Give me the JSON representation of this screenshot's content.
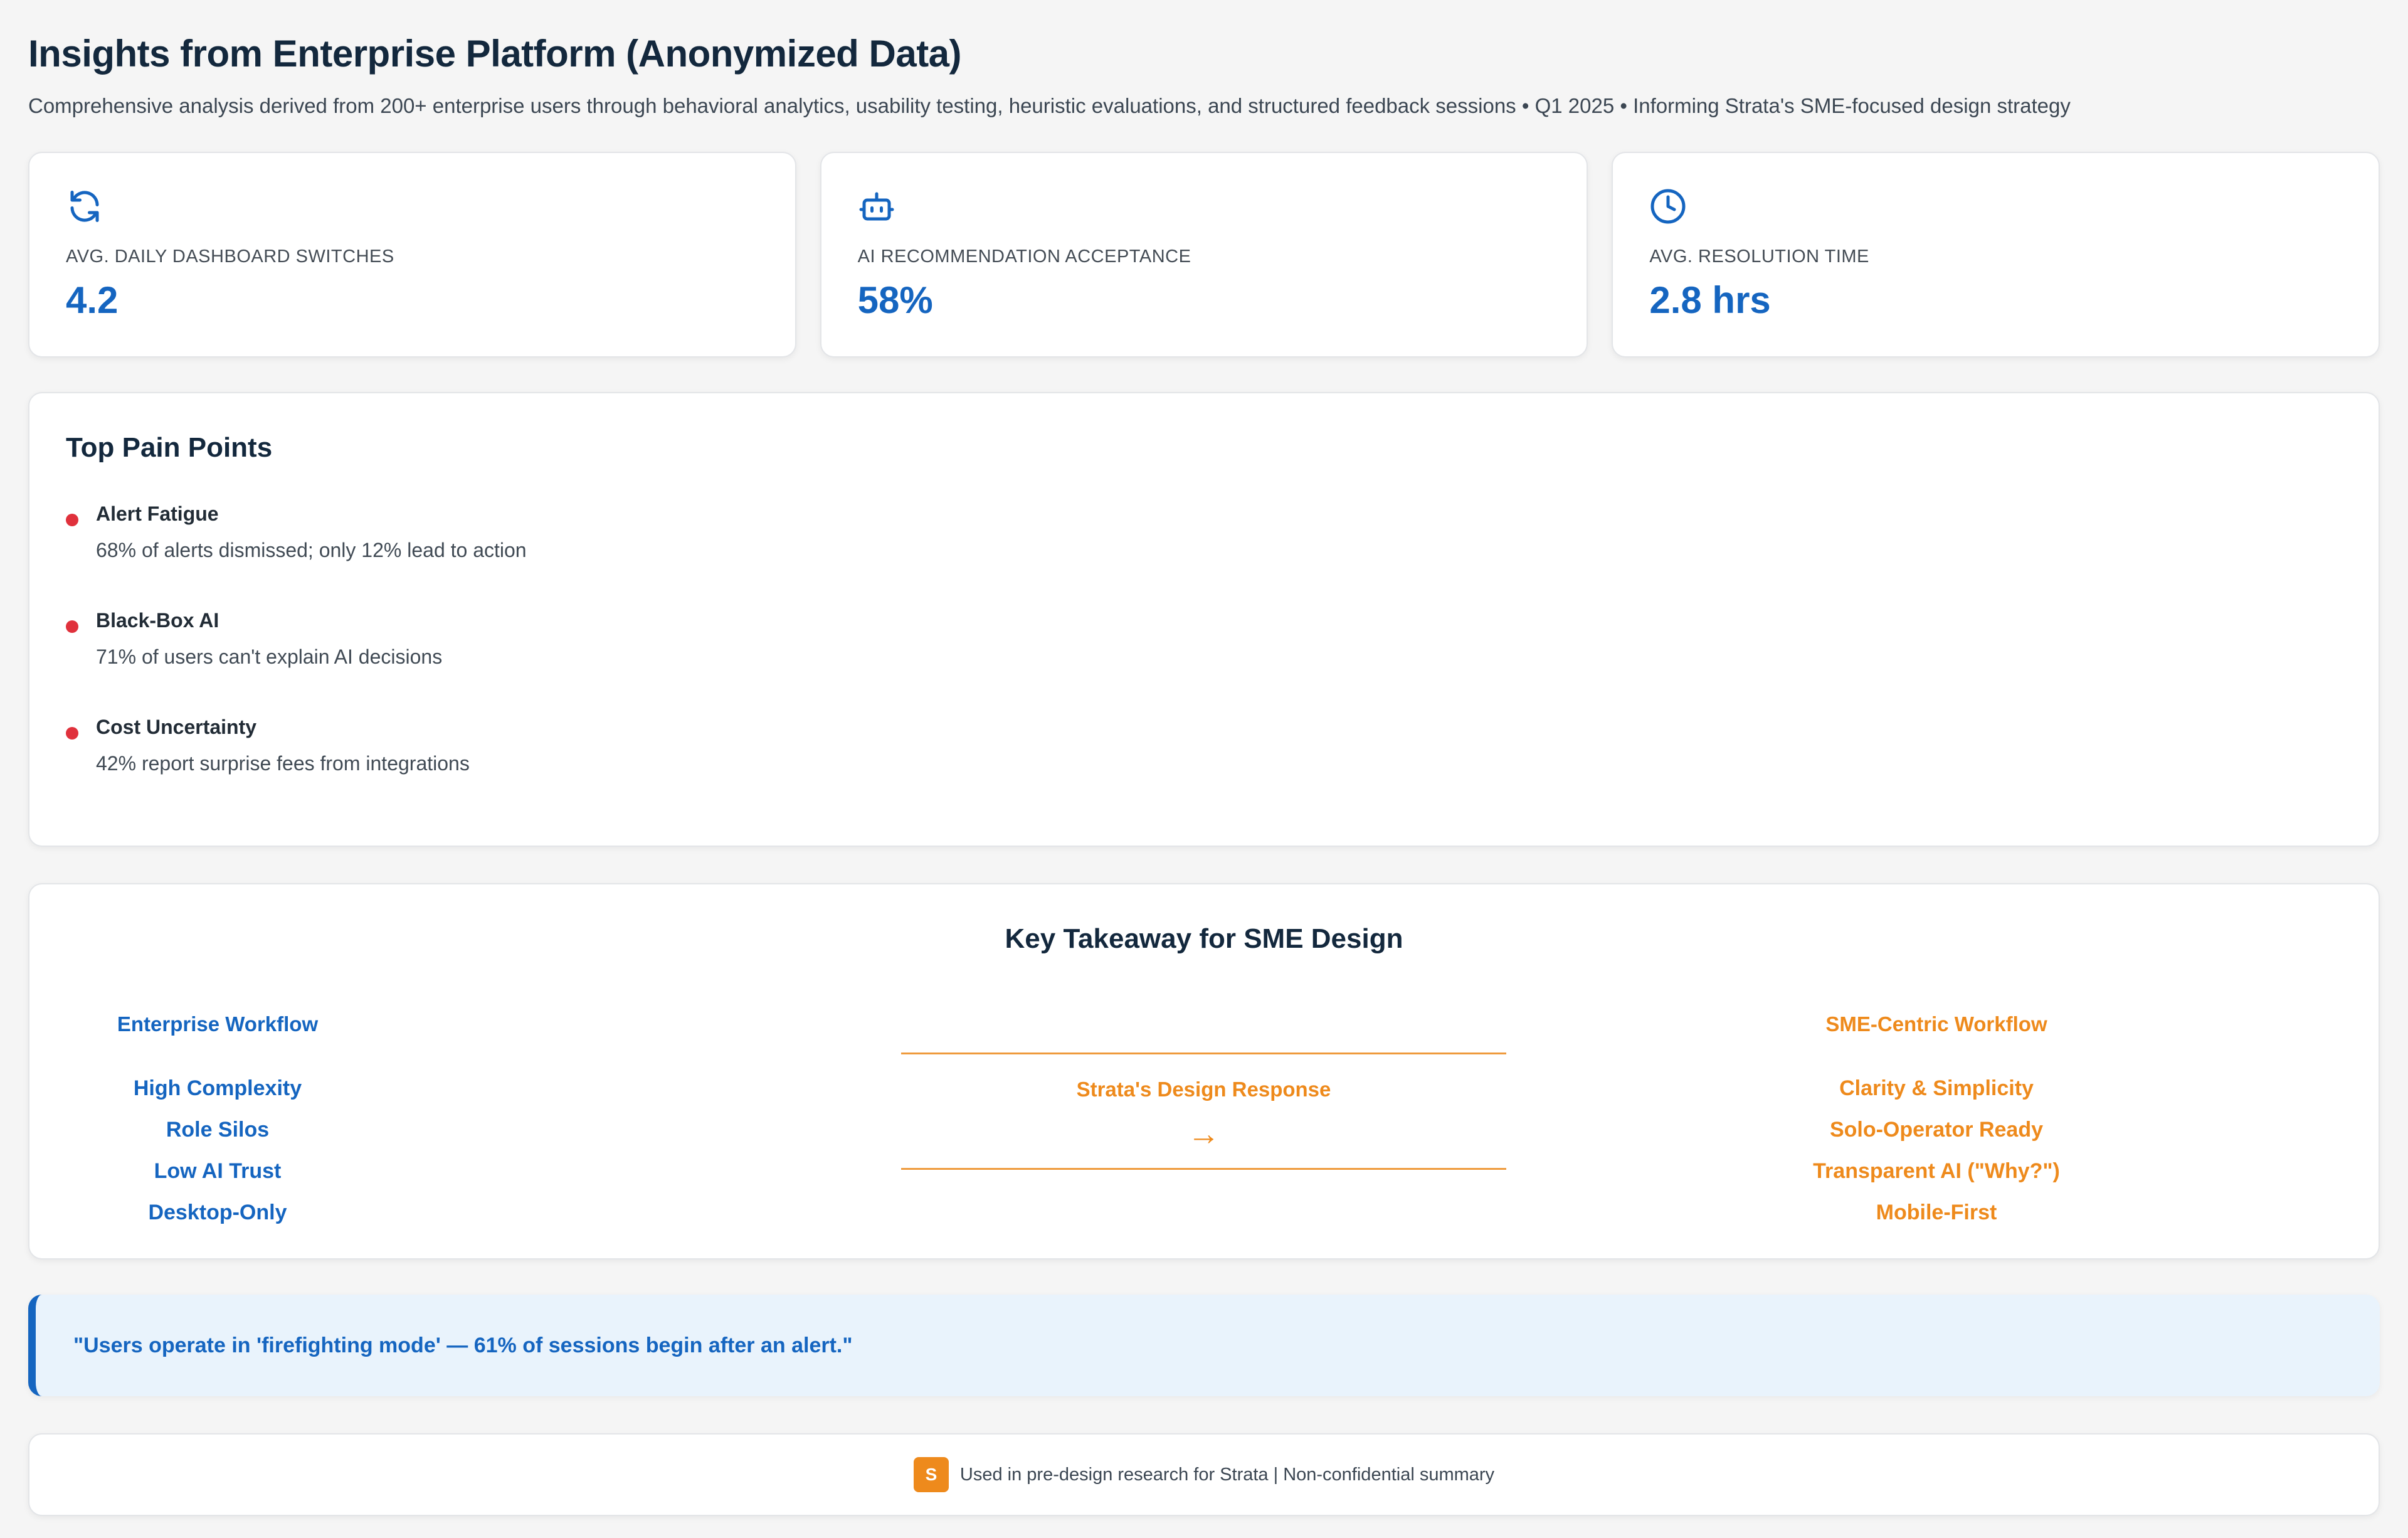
{
  "header": {
    "title": "Insights from Enterprise Platform (Anonymized Data)",
    "subtitle": "Comprehensive analysis derived from 200+ enterprise users through behavioral analytics, usability testing, heuristic evaluations, and structured feedback sessions • Q1 2025 • Informing Strata's SME-focused design strategy"
  },
  "stats": [
    {
      "icon": "refresh-icon",
      "label": "AVG. DAILY DASHBOARD SWITCHES",
      "value": "4.2"
    },
    {
      "icon": "robot-icon",
      "label": "AI RECOMMENDATION ACCEPTANCE",
      "value": "58%"
    },
    {
      "icon": "clock-icon",
      "label": "AVG. RESOLUTION TIME",
      "value": "2.8 hrs"
    }
  ],
  "pain_points": {
    "title": "Top Pain Points",
    "bullet_color": "#e0313c",
    "items": [
      {
        "name": "Alert Fatigue",
        "desc": "68% of alerts dismissed; only 12% lead to action"
      },
      {
        "name": "Black-Box AI",
        "desc": "71% of users can't explain AI decisions"
      },
      {
        "name": "Cost Uncertainty",
        "desc": "42% report surprise fees from integrations"
      }
    ]
  },
  "takeaway": {
    "title": "Key Takeaway for SME Design",
    "left": {
      "heading": "Enterprise Workflow",
      "items": [
        "High Complexity",
        "Role Silos",
        "Low AI Trust",
        "Desktop-Only"
      ]
    },
    "middle": {
      "label": "Strata's Design Response",
      "arrow": "→"
    },
    "right": {
      "heading": "SME-Centric Workflow",
      "items": [
        "Clarity & Simplicity",
        "Solo-Operator Ready",
        "Transparent AI (\"Why?\")",
        "Mobile-First"
      ]
    }
  },
  "quote": {
    "text": "\"Users operate in 'firefighting mode' — 61% of sessions begin after an alert.\""
  },
  "footer": {
    "badge": "S",
    "text": "Used in pre-design research for Strata | Non-confidential summary"
  },
  "colors": {
    "accent_blue": "#1565c0",
    "accent_orange": "#ee8a1c",
    "alert_red": "#e0313c"
  }
}
